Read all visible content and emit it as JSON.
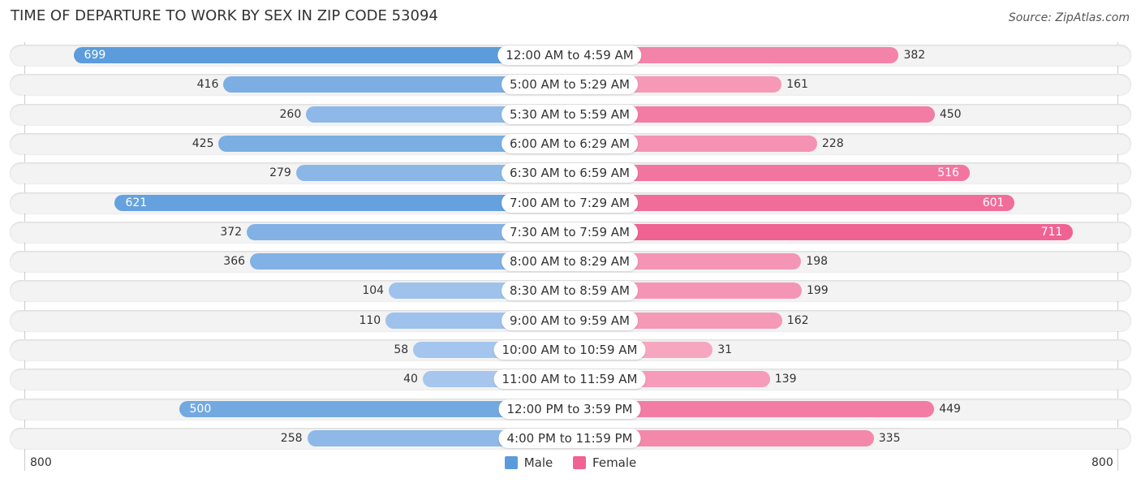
{
  "title": "TIME OF DEPARTURE TO WORK BY SEX IN ZIP CODE 53094",
  "source": "Source: ZipAtlas.com",
  "colors": {
    "male_strong": "#5b9bdc",
    "male_light": "#aac9ee",
    "female_strong": "#f06292",
    "female_light": "#f7a9c2"
  },
  "legend": {
    "male": "Male",
    "female": "Female"
  },
  "axis": {
    "left_tick": "800",
    "right_tick": "800"
  },
  "chart_data": {
    "type": "bar",
    "orientation": "horizontal-diverging",
    "title": "TIME OF DEPARTURE TO WORK BY SEX IN ZIP CODE 53094",
    "categories": [
      "12:00 AM to 4:59 AM",
      "5:00 AM to 5:29 AM",
      "5:30 AM to 5:59 AM",
      "6:00 AM to 6:29 AM",
      "6:30 AM to 6:59 AM",
      "7:00 AM to 7:29 AM",
      "7:30 AM to 7:59 AM",
      "8:00 AM to 8:29 AM",
      "8:30 AM to 8:59 AM",
      "9:00 AM to 9:59 AM",
      "10:00 AM to 10:59 AM",
      "11:00 AM to 11:59 AM",
      "12:00 PM to 3:59 PM",
      "4:00 PM to 11:59 PM"
    ],
    "series": [
      {
        "name": "Male",
        "values": [
          699,
          416,
          260,
          425,
          279,
          621,
          372,
          366,
          104,
          110,
          58,
          40,
          500,
          258
        ]
      },
      {
        "name": "Female",
        "values": [
          382,
          161,
          450,
          228,
          516,
          601,
          711,
          198,
          199,
          162,
          31,
          139,
          449,
          335
        ]
      }
    ],
    "xlim": [
      -800,
      800
    ],
    "xlabel": "",
    "ylabel": "",
    "legend_position": "bottom-center",
    "grid": false
  }
}
